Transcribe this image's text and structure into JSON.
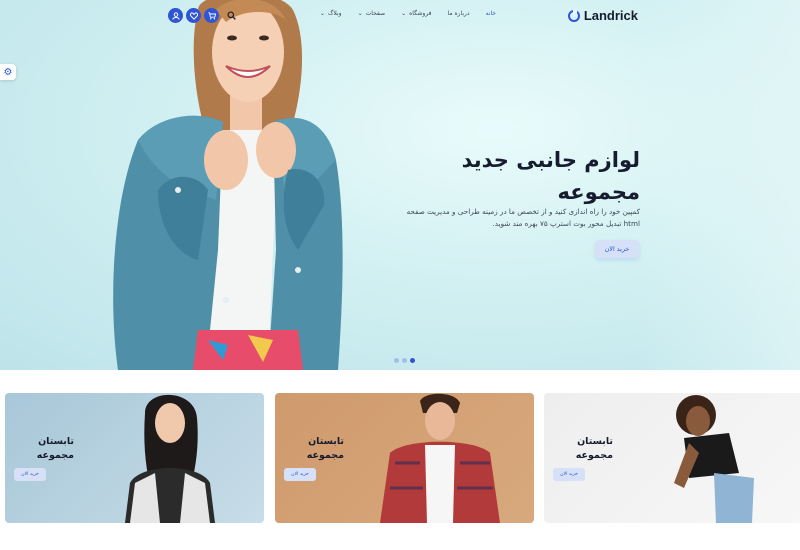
{
  "header": {
    "logo_text": "Landrick",
    "menu": [
      {
        "label": "خانه",
        "active": true,
        "dropdown": false
      },
      {
        "label": "درباره ما",
        "active": false,
        "dropdown": false
      },
      {
        "label": "فروشگاه",
        "active": false,
        "dropdown": true
      },
      {
        "label": "صفحات",
        "active": false,
        "dropdown": true
      },
      {
        "label": "وبلاگ",
        "active": false,
        "dropdown": true
      }
    ],
    "icons": [
      "user-icon",
      "heart-icon",
      "cart-icon",
      "search-icon"
    ]
  },
  "hero": {
    "title_line1": "لوازم جانبی جدید",
    "title_line2": "مجموعه",
    "description_line1": "کمپین خود را راه اندازی کنید و از تخصص ما در زمینه طراحی و مدیریت صفحه",
    "description_line2": "html تبدیل محور بوت استرپ ۷۵ بهره مند شوید.",
    "button_label": "خرید الان",
    "slides_count": 3,
    "active_slide": 3
  },
  "collections": [
    {
      "title_line1": "تابستان",
      "title_line2": "مجموعه",
      "button_label": "خرید الان"
    },
    {
      "title_line1": "تابستان",
      "title_line2": "مجموعه",
      "button_label": "خرید الان"
    },
    {
      "title_line1": "تابستان",
      "title_line2": "مجموعه",
      "button_label": "خرید الان"
    }
  ],
  "colors": {
    "primary": "#2f55d4",
    "heading": "#161c2d",
    "muted": "#3c4858"
  }
}
